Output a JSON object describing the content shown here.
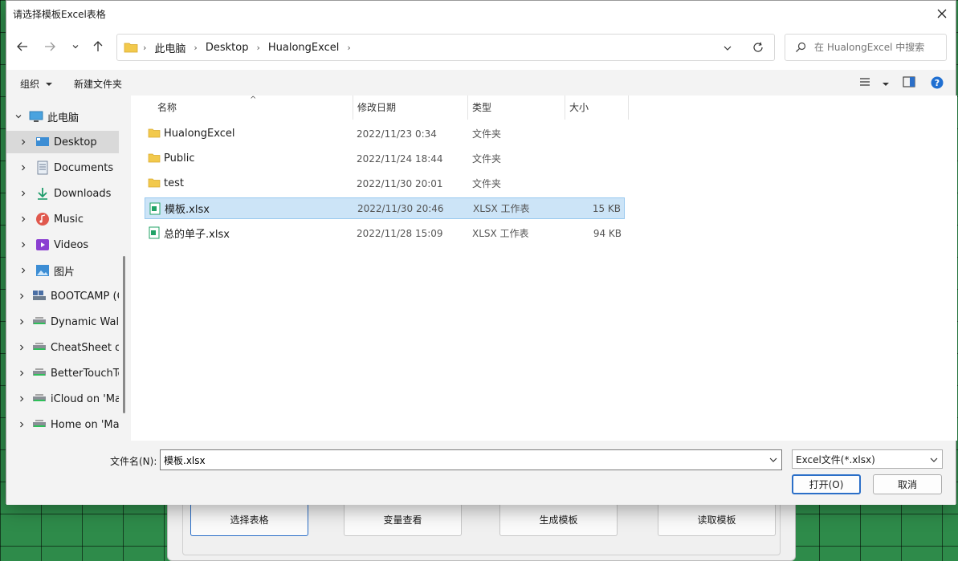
{
  "background_app": {
    "buttons": [
      {
        "label": "选择表格"
      },
      {
        "label": "变量查看"
      },
      {
        "label": "生成模板"
      },
      {
        "label": "读取模板"
      }
    ]
  },
  "dialog": {
    "title": "请选择模板Excel表格",
    "breadcrumb": [
      "此电脑",
      "Desktop",
      "HualongExcel"
    ],
    "search_placeholder": "在 HualongExcel 中搜索",
    "toolbar": {
      "organize": "组织",
      "new_folder": "新建文件夹"
    },
    "sidebar": {
      "root": "此电脑",
      "items": [
        {
          "label": "Desktop"
        },
        {
          "label": "Documents"
        },
        {
          "label": "Downloads"
        },
        {
          "label": "Music"
        },
        {
          "label": "Videos"
        },
        {
          "label": "图片"
        },
        {
          "label": "BOOTCAMP (C"
        },
        {
          "label": "Dynamic Wallp"
        },
        {
          "label": "CheatSheet on"
        },
        {
          "label": "BetterTouchTo"
        },
        {
          "label": "iCloud on 'Ma"
        },
        {
          "label": "Home on 'Ma"
        }
      ]
    },
    "columns": {
      "name": "名称",
      "modified": "修改日期",
      "type": "类型",
      "size": "大小"
    },
    "files": [
      {
        "name": "HualongExcel",
        "modified": "2022/11/23 0:34",
        "type": "文件夹",
        "size": ""
      },
      {
        "name": "Public",
        "modified": "2022/11/24 18:44",
        "type": "文件夹",
        "size": ""
      },
      {
        "name": "test",
        "modified": "2022/11/30 20:01",
        "type": "文件夹",
        "size": ""
      },
      {
        "name": "模板.xlsx",
        "modified": "2022/11/30 20:46",
        "type": "XLSX 工作表",
        "size": "15 KB"
      },
      {
        "name": "总的单子.xlsx",
        "modified": "2022/11/28 15:09",
        "type": "XLSX 工作表",
        "size": "94 KB"
      }
    ],
    "filename_label": "文件名(N):",
    "filename_value": "模板.xlsx",
    "filter_value": "Excel文件(*.xlsx)",
    "open_label": "打开(O)",
    "cancel_label": "取消",
    "colors": {
      "selection": "#cce4f7",
      "accent": "#2b6fc8",
      "folder": "#f2c94c",
      "excel": "#21a366"
    }
  }
}
